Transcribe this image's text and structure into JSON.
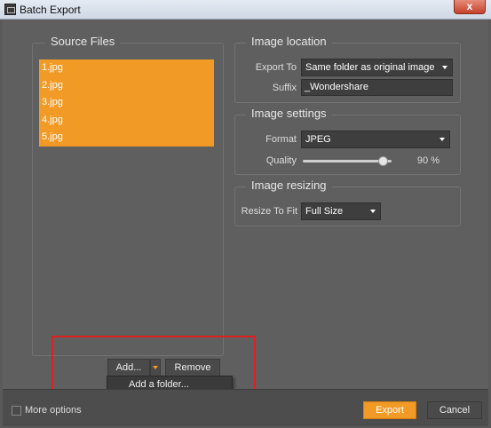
{
  "window": {
    "title": "Batch Export",
    "close_label": "x"
  },
  "source_files": {
    "title": "Source Files",
    "items": [
      "1.jpg",
      "2.jpg",
      "3.jpg",
      "4.jpg",
      "5.jpg"
    ]
  },
  "image_location": {
    "title": "Image location",
    "export_to_label": "Export To",
    "export_to_value": "Same folder as original image",
    "suffix_label": "Suffix",
    "suffix_value": "_Wondershare"
  },
  "image_settings": {
    "title": "Image settings",
    "format_label": "Format",
    "format_value": "JPEG",
    "quality_label": "Quality",
    "quality_value": 90,
    "quality_display": "90 %"
  },
  "image_resizing": {
    "title": "Image resizing",
    "resize_label": "Resize To Fit",
    "resize_value": "Full Size"
  },
  "file_buttons": {
    "add_label": "Add...",
    "remove_label": "Remove",
    "menu_item": "Add a folder..."
  },
  "footer": {
    "more_options_label": "More options",
    "export_label": "Export",
    "cancel_label": "Cancel"
  },
  "colors": {
    "accent": "#f29a26",
    "highlight_box": "#e02020"
  }
}
